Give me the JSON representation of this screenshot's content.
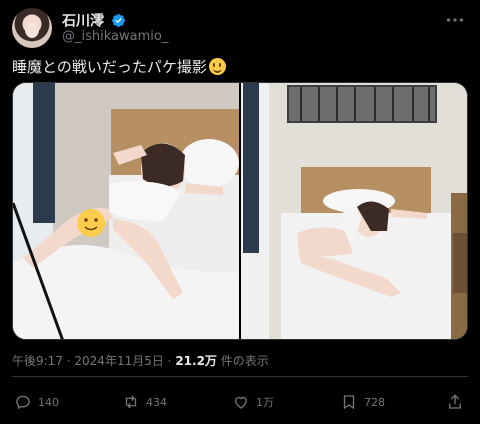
{
  "author": {
    "display_name": "石川澪",
    "handle": "@_ishikawamio_"
  },
  "tweet": {
    "text": "睡魔との戦いだったパケ撮影"
  },
  "meta": {
    "time": "午後9:17",
    "separator": " · ",
    "date": "2024年11月5日",
    "views": "21.2万",
    "views_suffix": " 件の表示"
  },
  "actions": {
    "replies": "140",
    "retweets": "434",
    "likes": "1万",
    "bookmarks": "728"
  },
  "icons": {
    "verified": "verified-badge-icon",
    "more": "more-icon",
    "reply": "reply-icon",
    "retweet": "retweet-icon",
    "like": "heart-icon",
    "bookmark": "bookmark-icon",
    "share": "share-icon"
  },
  "colors": {
    "background": "#000000",
    "text": "#e7e9ea",
    "muted": "#71767b",
    "verified": "#1d9bf0",
    "border": "#2f3336"
  }
}
